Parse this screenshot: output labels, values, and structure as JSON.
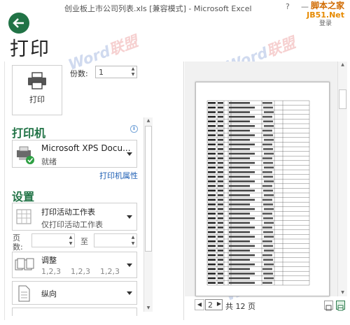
{
  "window": {
    "title": "创业板上市公司列表.xls  [兼容模式] - Microsoft Excel",
    "help": "?",
    "minimize": "—"
  },
  "brand": {
    "line1": "脚本之家",
    "line2": "JB51.Net"
  },
  "account": {
    "login": "登录"
  },
  "page_title": "打印",
  "watermark": {
    "word": "Word",
    "cn": "联盟"
  },
  "print_button": {
    "label": "打印"
  },
  "copies": {
    "label": "份数:",
    "value": "1"
  },
  "printer": {
    "heading": "打印机",
    "name": "Microsoft XPS Docu...",
    "status": "就绪",
    "properties_link": "打印机属性"
  },
  "settings": {
    "heading": "设置",
    "print_what": {
      "main": "打印活动工作表",
      "sub": "仅打印活动工作表"
    },
    "pages": {
      "label_line1": "页",
      "label_line2": "数:",
      "to_label": "至",
      "from": "",
      "to": ""
    },
    "collate": {
      "main": "调整",
      "sub": "1,2,3    1,2,3    1,2,3"
    },
    "orientation": {
      "main": "纵向"
    }
  },
  "pager": {
    "current": "2",
    "total_text": "共 12 页"
  },
  "colors": {
    "accent": "#217346",
    "link": "#1e5fb4"
  }
}
